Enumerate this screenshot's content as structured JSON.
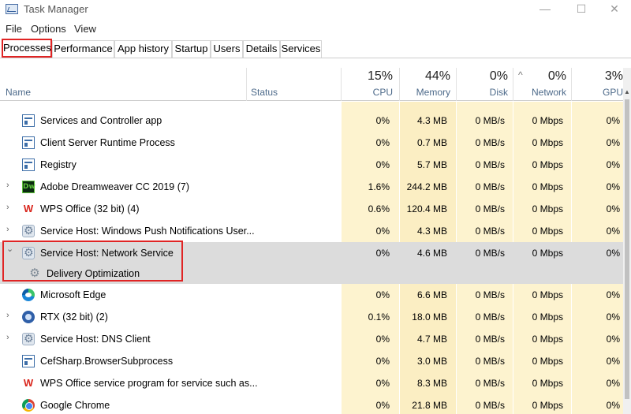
{
  "window": {
    "title": "Task Manager",
    "minimize": "—",
    "maximize": "☐",
    "close": "✕"
  },
  "menu": [
    "File",
    "Options",
    "View"
  ],
  "tabs": [
    "Processes",
    "Performance",
    "App history",
    "Startup",
    "Users",
    "Details",
    "Services"
  ],
  "active_tab": "Processes",
  "columns": {
    "name": "Name",
    "status": "Status",
    "cpu": {
      "pct": "15%",
      "label": "CPU"
    },
    "memory": {
      "pct": "44%",
      "label": "Memory"
    },
    "disk": {
      "pct": "0%",
      "label": "Disk"
    },
    "network": {
      "pct": "0%",
      "label": "Network"
    },
    "gpu": {
      "pct": "3%",
      "label": "GPU"
    }
  },
  "processes": [
    {
      "name": "Services and Controller app",
      "icon": "app-window-icon",
      "expandable": false,
      "cpu": "0%",
      "memory": "4.3 MB",
      "disk": "0 MB/s",
      "network": "0 Mbps",
      "gpu": "0%"
    },
    {
      "name": "Client Server Runtime Process",
      "icon": "app-window-icon",
      "expandable": false,
      "cpu": "0%",
      "memory": "0.7 MB",
      "disk": "0 MB/s",
      "network": "0 Mbps",
      "gpu": "0%"
    },
    {
      "name": "Registry",
      "icon": "app-window-icon",
      "expandable": false,
      "cpu": "0%",
      "memory": "5.7 MB",
      "disk": "0 MB/s",
      "network": "0 Mbps",
      "gpu": "0%"
    },
    {
      "name": "Adobe Dreamweaver CC 2019 (7)",
      "icon": "dreamweaver-icon",
      "expandable": true,
      "cpu": "1.6%",
      "memory": "244.2 MB",
      "disk": "0 MB/s",
      "network": "0 Mbps",
      "gpu": "0%"
    },
    {
      "name": "WPS Office (32 bit) (4)",
      "icon": "wps-icon",
      "expandable": true,
      "cpu": "0.6%",
      "memory": "120.4 MB",
      "disk": "0 MB/s",
      "network": "0 Mbps",
      "gpu": "0%"
    },
    {
      "name": "Service Host: Windows Push Notifications User...",
      "icon": "gear-icon",
      "expandable": true,
      "cpu": "0%",
      "memory": "4.3 MB",
      "disk": "0 MB/s",
      "network": "0 Mbps",
      "gpu": "0%"
    },
    {
      "name": "Service Host: Network Service",
      "icon": "gear-icon",
      "expandable": true,
      "expanded": true,
      "cpu": "0%",
      "memory": "4.6 MB",
      "disk": "0 MB/s",
      "network": "0 Mbps",
      "gpu": "0%"
    },
    {
      "name": "Delivery Optimization",
      "icon": "delivery-optimization-icon",
      "child": true
    },
    {
      "name": "Microsoft Edge",
      "icon": "edge-icon",
      "expandable": false,
      "cpu": "0%",
      "memory": "6.6 MB",
      "disk": "0 MB/s",
      "network": "0 Mbps",
      "gpu": "0%"
    },
    {
      "name": "RTX (32 bit) (2)",
      "icon": "rtx-icon",
      "expandable": true,
      "cpu": "0.1%",
      "memory": "18.0 MB",
      "disk": "0 MB/s",
      "network": "0 Mbps",
      "gpu": "0%"
    },
    {
      "name": "Service Host: DNS Client",
      "icon": "gear-icon",
      "expandable": true,
      "cpu": "0%",
      "memory": "4.7 MB",
      "disk": "0 MB/s",
      "network": "0 Mbps",
      "gpu": "0%"
    },
    {
      "name": "CefSharp.BrowserSubprocess",
      "icon": "app-window-icon",
      "expandable": false,
      "cpu": "0%",
      "memory": "3.0 MB",
      "disk": "0 MB/s",
      "network": "0 Mbps",
      "gpu": "0%"
    },
    {
      "name": "WPS Office service program for service such as...",
      "icon": "wps-icon",
      "expandable": false,
      "cpu": "0%",
      "memory": "8.3 MB",
      "disk": "0 MB/s",
      "network": "0 Mbps",
      "gpu": "0%"
    },
    {
      "name": "Google Chrome",
      "icon": "chrome-icon",
      "expandable": false,
      "cpu": "0%",
      "memory": "21.8 MB",
      "disk": "0 MB/s",
      "network": "0 Mbps",
      "gpu": "0%"
    }
  ],
  "colors": {
    "accent_red": "#e02424",
    "heat_light": "#fdf3cf",
    "selected_row": "#dcdcdc"
  }
}
